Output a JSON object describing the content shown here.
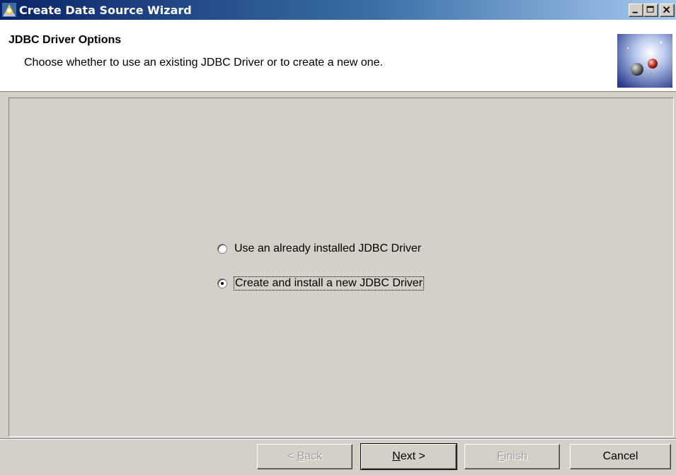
{
  "window": {
    "title": "Create Data Source Wizard",
    "controls": {
      "minimize": "minimize-icon",
      "maximize": "maximize-icon",
      "close": "close-icon"
    }
  },
  "header": {
    "title": "JDBC Driver Options",
    "description": "Choose whether to use an existing JDBC Driver or to create a new one.",
    "image": "wizard-banner-graphic"
  },
  "options": [
    {
      "label": "Use an already installed JDBC Driver",
      "checked": false
    },
    {
      "label": "Create and install a new JDBC Driver",
      "checked": true
    }
  ],
  "buttons": {
    "back": {
      "label": "< Back",
      "mnemonic": "B",
      "enabled": false
    },
    "next": {
      "label": "Next >",
      "mnemonic": "N",
      "enabled": true,
      "default": true
    },
    "finish": {
      "label": "Finish",
      "mnemonic": "F",
      "enabled": false
    },
    "cancel": {
      "label": "Cancel",
      "enabled": true
    }
  },
  "colors": {
    "titlebar_start": "#0a246a",
    "titlebar_end": "#a6caf0",
    "face": "#d4d0c8",
    "header_bg": "#ffffff"
  }
}
